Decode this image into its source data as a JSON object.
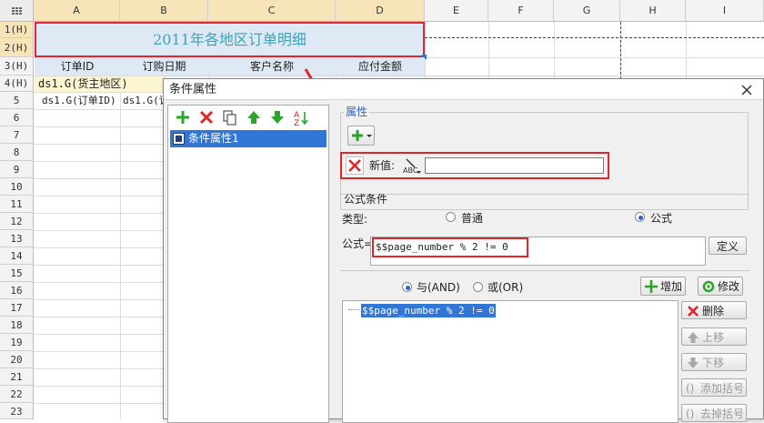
{
  "sheet": {
    "corner_icon": "grid-icon",
    "columns": [
      "A",
      "B",
      "C",
      "D",
      "E",
      "F",
      "G",
      "H",
      "I"
    ],
    "rows": [
      "1(H)",
      "2(H)",
      "3(H)",
      "4(H)",
      "5",
      "6",
      "7",
      "8",
      "9",
      "10",
      "11",
      "12",
      "13",
      "14",
      "15",
      "16",
      "17",
      "18",
      "19",
      "20",
      "21",
      "22",
      "23"
    ],
    "title_cell": "2011年各地区订单明细",
    "headers": {
      "a": "订单ID",
      "b": "订购日期",
      "c": "客户名称",
      "d": "应付金额"
    },
    "group_cell": "ds1.G(货主地区)",
    "detail_a": "ds1.G(订单ID)",
    "detail_b": "ds1.G(订"
  },
  "dialog": {
    "title": "条件属性",
    "close_icon": "close-icon",
    "toolbar_icons": [
      "add-icon",
      "delete-icon",
      "copy-icon",
      "move-up-icon",
      "move-down-icon",
      "sort-icon"
    ],
    "list_items": [
      "条件属性1"
    ],
    "properties_label": "属性",
    "new_value_label": "新值:",
    "new_value": "",
    "formula_section_label": "公式条件",
    "type_label": "类型:",
    "type_options": [
      {
        "label": "普通",
        "selected": false
      },
      {
        "label": "公式",
        "selected": true
      }
    ],
    "formula_label": "公式=",
    "formula_value": "$$page_number % 2 != 0",
    "define_button": "定义",
    "logic_options": [
      {
        "label": "与(AND)",
        "selected": true
      },
      {
        "label": "或(OR)",
        "selected": false
      }
    ],
    "add_button": "增加",
    "modify_button": "修改",
    "condition_items": [
      "$$page_number % 2 != 0"
    ],
    "side_buttons": {
      "delete": "删除",
      "up": "上移",
      "down": "下移",
      "add_bracket": "添加括号",
      "remove_bracket": "去掉括号"
    }
  },
  "colors": {
    "accent_red": "#e0262c",
    "title_text": "#3aa3b8",
    "selection_blue": "#3076d6",
    "green": "#2aa52a"
  }
}
